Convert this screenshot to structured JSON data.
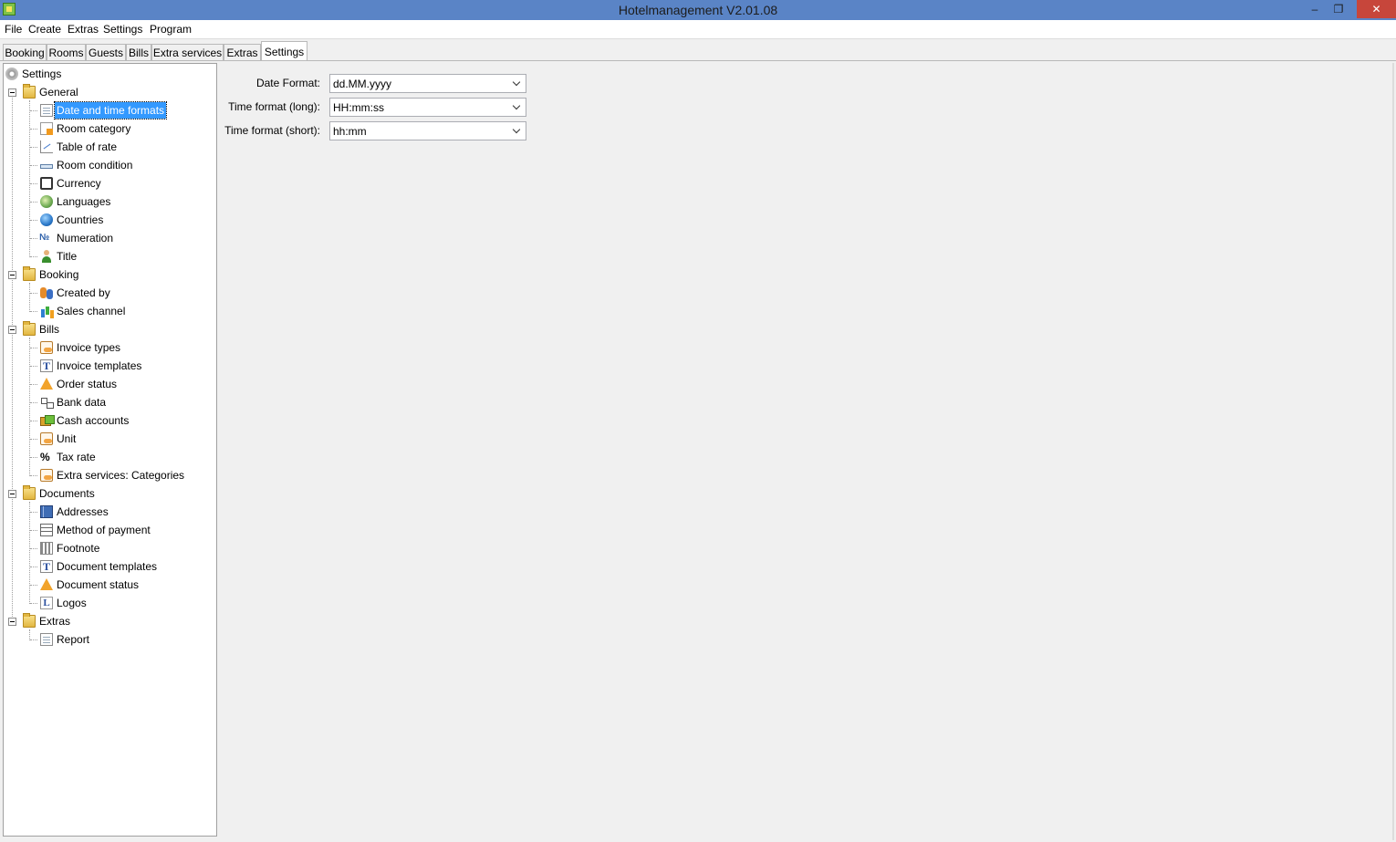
{
  "window": {
    "title": "Hotelmanagement V2.01.08",
    "min": "–",
    "max": "❐",
    "close": "✕"
  },
  "menu": [
    "File",
    "Create",
    "Extras",
    "Settings",
    "Program"
  ],
  "tabs": [
    "Booking",
    "Rooms",
    "Guests",
    "Bills",
    "Extra services",
    "Extras",
    "Settings"
  ],
  "active_tab": "Settings",
  "tree": {
    "root": "Settings",
    "groups": [
      {
        "label": "General",
        "items": [
          {
            "label": "Date and time formats",
            "icon": "document-icon",
            "selected": true
          },
          {
            "label": "Room category",
            "icon": "room-category-icon"
          },
          {
            "label": "Table of rate",
            "icon": "chart-icon"
          },
          {
            "label": "Room condition",
            "icon": "bed-icon"
          },
          {
            "label": "Currency",
            "icon": "currency-icon"
          },
          {
            "label": "Languages",
            "icon": "languages-icon"
          },
          {
            "label": "Countries",
            "icon": "globe-icon"
          },
          {
            "label": "Numeration",
            "icon": "numero-icon"
          },
          {
            "label": "Title",
            "icon": "person-icon"
          }
        ]
      },
      {
        "label": "Booking",
        "items": [
          {
            "label": "Created by",
            "icon": "people-icon"
          },
          {
            "label": "Sales channel",
            "icon": "bar-chart-icon"
          }
        ]
      },
      {
        "label": "Bills",
        "items": [
          {
            "label": "Invoice types",
            "icon": "invoice-icon"
          },
          {
            "label": "Invoice templates",
            "icon": "template-icon"
          },
          {
            "label": "Order status",
            "icon": "warning-icon"
          },
          {
            "label": "Bank data",
            "icon": "bank-tree-icon"
          },
          {
            "label": "Cash accounts",
            "icon": "cash-icon"
          },
          {
            "label": "Unit",
            "icon": "unit-icon"
          },
          {
            "label": "Tax rate",
            "icon": "percent-icon"
          },
          {
            "label": "Extra services: Categories",
            "icon": "extra-services-icon"
          }
        ]
      },
      {
        "label": "Documents",
        "items": [
          {
            "label": "Addresses",
            "icon": "address-book-icon"
          },
          {
            "label": "Method of payment",
            "icon": "payment-grid-icon"
          },
          {
            "label": "Footnote",
            "icon": "footnote-icon"
          },
          {
            "label": "Document templates",
            "icon": "template-icon"
          },
          {
            "label": "Document status",
            "icon": "warning-icon"
          },
          {
            "label": "Logos",
            "icon": "logo-icon"
          }
        ]
      },
      {
        "label": "Extras",
        "items": [
          {
            "label": "Report",
            "icon": "report-icon"
          }
        ]
      }
    ]
  },
  "form": {
    "date_format_label": "Date Format:",
    "date_format_value": "dd.MM.yyyy",
    "time_long_label": "Time format (long):",
    "time_long_value": "HH:mm:ss",
    "time_short_label": "Time format (short):",
    "time_short_value": "hh:mm"
  },
  "colors": {
    "titlebar": "#5a84c6",
    "selection": "#3399ff",
    "close": "#c7463b"
  }
}
